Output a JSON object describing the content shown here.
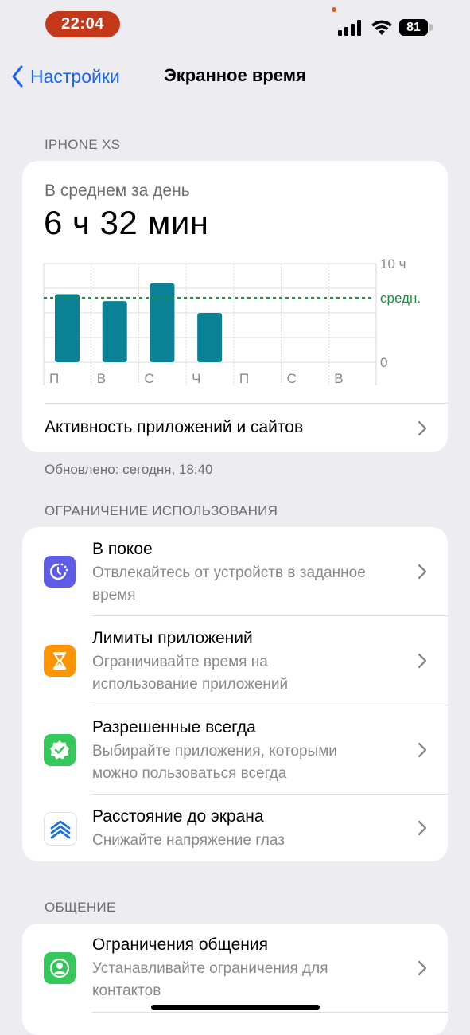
{
  "status_bar": {
    "time": "22:04",
    "battery": "81",
    "icons": [
      "cellular-signal-icon",
      "wifi-icon",
      "battery-icon"
    ]
  },
  "nav": {
    "back_label": "Настройки",
    "title": "Экранное время"
  },
  "device_header": "IPHONE XS",
  "summary": {
    "avg_label": "В среднем за день",
    "avg_value": "6 ч 32 мин",
    "activity_link": "Активность приложений и сайтов",
    "updated": "Обновлено: сегодня, 18:40"
  },
  "chart_data": {
    "type": "bar",
    "categories": [
      "П",
      "В",
      "С",
      "Ч",
      "П",
      "С",
      "В"
    ],
    "values": [
      6.9,
      6.2,
      8.0,
      5.0,
      null,
      null,
      null
    ],
    "average": 6.53,
    "average_label": "средн.",
    "y_tick_labels": [
      "10 ч",
      "0"
    ],
    "ylim": [
      0,
      10
    ],
    "grid": true,
    "bar_color": "#0b8195",
    "average_color": "#1e8f3a"
  },
  "limits": {
    "header": "ОГРАНИЧЕНИЕ ИСПОЛЬЗОВАНИЯ",
    "items": [
      {
        "title": "В покое",
        "subtitle": "Отвлекайтесь от устройств в заданное время",
        "icon": "downtime-icon",
        "color": "#5e5ce6"
      },
      {
        "title": "Лимиты приложений",
        "subtitle": "Ограничивайте время на использование приложений",
        "icon": "hourglass-icon",
        "color": "#ff9500"
      },
      {
        "title": "Разрешенные всегда",
        "subtitle": "Выбирайте приложения, которыми можно пользоваться всегда",
        "icon": "checkmark-seal-icon",
        "color": "#34c759"
      },
      {
        "title": "Расстояние до экрана",
        "subtitle": "Снижайте напряжение глаз",
        "icon": "chevrons-up-icon",
        "color": "#1a73e8"
      }
    ]
  },
  "communication": {
    "header": "ОБЩЕНИЕ",
    "items": [
      {
        "title": "Ограничения общения",
        "subtitle": "Устанавливайте ограничения для контактов",
        "icon": "contact-icon",
        "color": "#34c759"
      }
    ]
  }
}
